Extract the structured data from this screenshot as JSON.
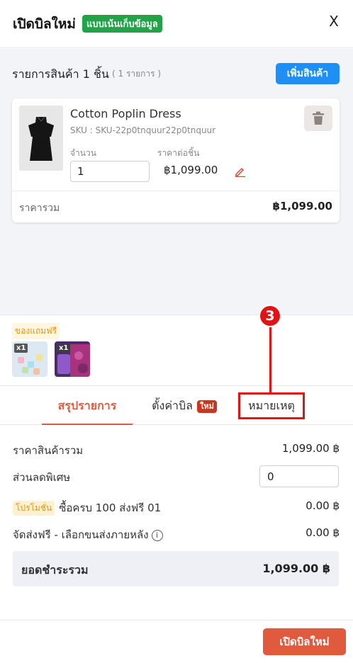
{
  "header": {
    "title": "เปิดบิลใหม่",
    "badge": "แบบเน้นเก็บข้อมูล",
    "close_label": "X"
  },
  "items": {
    "title": "รายการสินค้า 1 ชิ้น",
    "count": "( 1 รายการ )",
    "add_button": "เพิ่มสินค้า",
    "product": {
      "name": "Cotton Poplin Dress",
      "sku": "SKU : SKU-22p0tnquur22p0tnquur",
      "qty_label": "จำนวน",
      "qty_value": "1",
      "price_label": "ราคาต่อชิ้น",
      "unit_price": "฿1,099.00",
      "total_label": "ราคารวม",
      "total_value": "฿1,099.00"
    }
  },
  "gifts": {
    "label": "ของแถมฟรี",
    "items": [
      {
        "badge": "x1"
      },
      {
        "badge": "x1"
      }
    ]
  },
  "tabs": [
    {
      "label": "สรุปรายการ"
    },
    {
      "label": "ตั้งค่าบิล",
      "badge": "ใหม่"
    },
    {
      "label": "หมายเหตุ"
    }
  ],
  "annotation": {
    "number": "3"
  },
  "summary": {
    "subtotal_label": "ราคาสินค้ารวม",
    "subtotal_value": "1,099.00 ฿",
    "discount_label": "ส่วนลดพิเศษ",
    "discount_value": "0",
    "promo_badge": "โปรโมชั่น",
    "promo_label": "ซื้อครบ 100 ส่งฟรี 01",
    "promo_value": "0.00 ฿",
    "shipping_label": "จัดส่งฟรี - เลือกขนส่งภายหลัง",
    "shipping_info": "i",
    "shipping_value": "0.00 ฿",
    "grand_label": "ยอดชำระรวม",
    "grand_value": "1,099.00 ฿"
  },
  "footer": {
    "submit_label": "เปิดบิลใหม่"
  },
  "colors": {
    "accent": "#e05a3e",
    "primary_blue": "#1e8ff5",
    "badge_green": "#22a34a",
    "annotation_red": "#e01414",
    "promo_orange": "#e3960e"
  },
  "icons": {
    "close": "close-icon",
    "trash": "trash-icon",
    "edit": "pencil-icon",
    "info": "info-icon"
  }
}
